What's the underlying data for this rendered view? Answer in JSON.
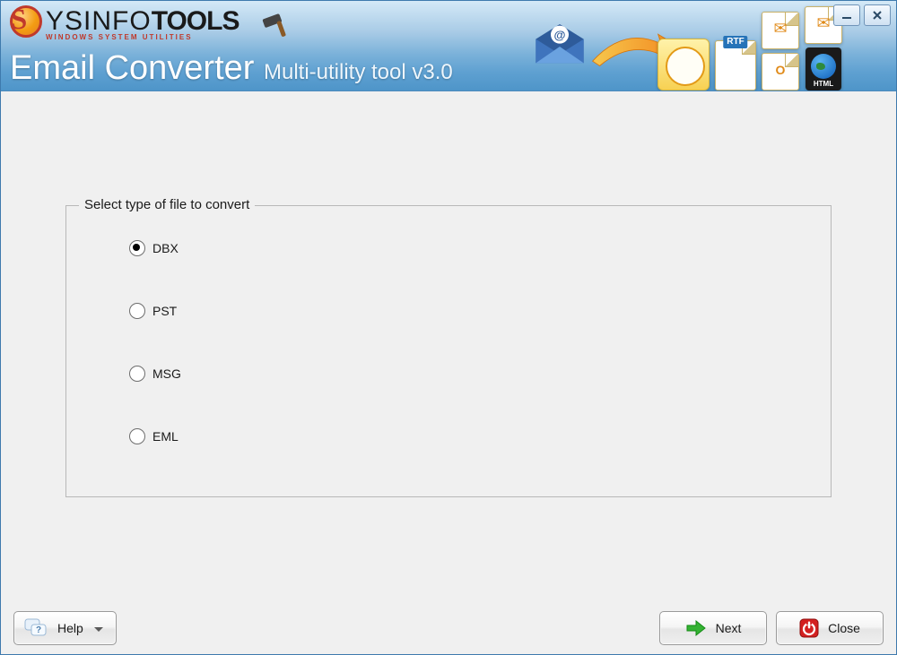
{
  "brand": {
    "name_main": "YSINFO",
    "name_secondary": "TOOLS",
    "tagline": "WINDOWS SYSTEM UTILITIES"
  },
  "product": {
    "title": "Email Converter",
    "subtitle": "Multi-utility tool v3.0"
  },
  "header_icons": {
    "rtf_label": "RTF",
    "html_label": "HTML"
  },
  "window_buttons": {
    "minimize": "minimize",
    "close": "close"
  },
  "group": {
    "legend": "Select type of file to convert",
    "options": [
      {
        "label": "DBX",
        "value": "dbx",
        "selected": true
      },
      {
        "label": "PST",
        "value": "pst",
        "selected": false
      },
      {
        "label": "MSG",
        "value": "msg",
        "selected": false
      },
      {
        "label": "EML",
        "value": "eml",
        "selected": false
      }
    ]
  },
  "footer": {
    "help": "Help",
    "next": "Next",
    "close": "Close"
  }
}
